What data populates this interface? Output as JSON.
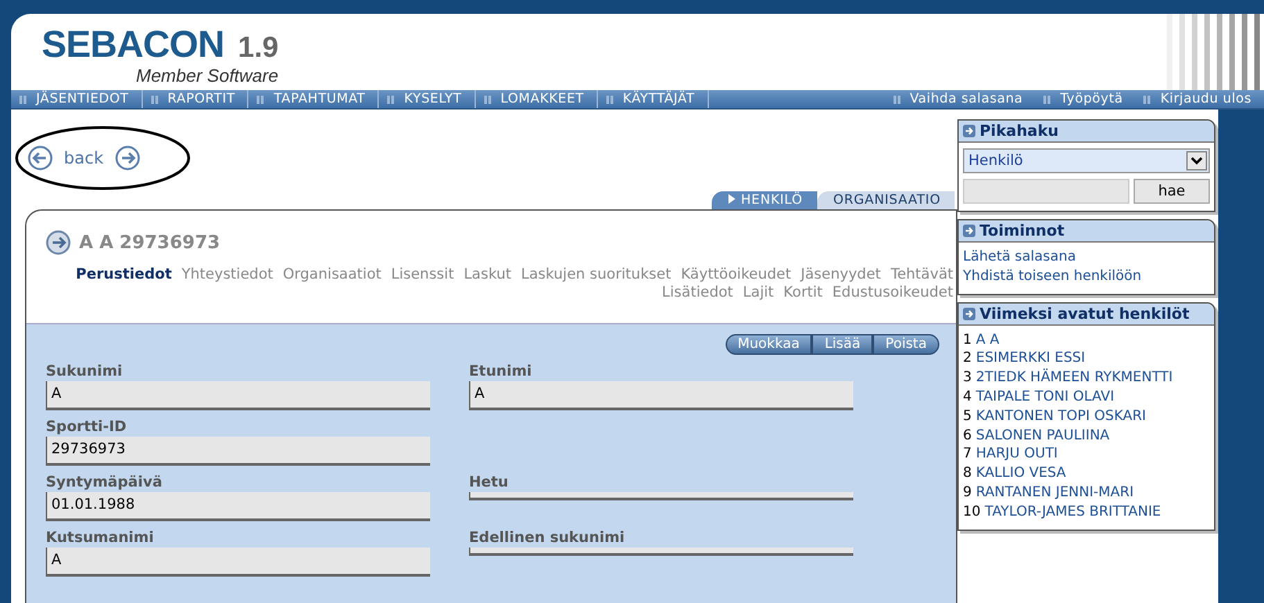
{
  "header": {
    "logo": "SEBACON",
    "version": "1.9",
    "subtitle": "Member Software"
  },
  "nav": {
    "left": [
      "JÄSENTIEDOT",
      "RAPORTIT",
      "TAPAHTUMAT",
      "KYSELYT",
      "LOMAKKEET",
      "KÄYTTÄJÄT"
    ],
    "right": [
      "Vaihda salasana",
      "Työpöytä",
      "Kirjaudu ulos"
    ]
  },
  "back": {
    "label": "back"
  },
  "entity_tabs": [
    {
      "label": "HENKILÖ",
      "selected": true
    },
    {
      "label": "ORGANISAATIO",
      "selected": false
    }
  ],
  "record": {
    "title": "A A 29736973",
    "subtab_rows": [
      {
        "items": [
          {
            "label": "Perustiedot",
            "selected": true
          },
          {
            "label": "Yhteystiedot",
            "selected": false
          },
          {
            "label": "Organisaatiot",
            "selected": false
          },
          {
            "label": "Lisenssit",
            "selected": false
          },
          {
            "label": "Laskut",
            "selected": false
          },
          {
            "label": "Laskujen suoritukset",
            "selected": false
          },
          {
            "label": "Käyttöoikeudet",
            "selected": false
          },
          {
            "label": "Jäsenyydet",
            "selected": false
          },
          {
            "label": "Tehtävät",
            "selected": false
          }
        ]
      },
      {
        "items": [
          {
            "label": "Lisätiedot",
            "selected": false
          },
          {
            "label": "Lajit",
            "selected": false
          },
          {
            "label": "Kortit",
            "selected": false
          },
          {
            "label": "Edustusoikeudet",
            "selected": false
          }
        ]
      }
    ],
    "actions": [
      "Muokkaa",
      "Lisää",
      "Poista"
    ],
    "field_rows": [
      {
        "left": {
          "label": "Sukunimi",
          "value": "A"
        },
        "right": {
          "label": "Etunimi",
          "value": "A"
        }
      },
      {
        "left": {
          "label": "Sportti-ID",
          "value": "29736973"
        }
      },
      {
        "left": {
          "label": "Syntymäpäivä",
          "value": "01.01.1988"
        },
        "right": {
          "label": "Hetu"
        }
      },
      {
        "left": {
          "label": "Kutsumanimi",
          "value": "A"
        },
        "right": {
          "label": "Edellinen sukunimi"
        }
      }
    ]
  },
  "sidebar": {
    "quick_search": {
      "title": "Pikahaku",
      "select": "Henkilö",
      "button": "hae"
    },
    "actions": {
      "title": "Toiminnot",
      "links": [
        "Lähetä salasana",
        "Yhdistä toiseen henkilöön"
      ]
    },
    "recent": {
      "title": "Viimeksi avatut henkilöt",
      "items": [
        {
          "number": "1",
          "name": "A A"
        },
        {
          "number": "2",
          "name": "ESIMERKKI ESSI"
        },
        {
          "number": "3",
          "name": "2TIEDK HÄMEEN RYKMENTTI"
        },
        {
          "number": "4",
          "name": "TAIPALE TONI OLAVI"
        },
        {
          "number": "5",
          "name": "KANTONEN TOPI OSKARI"
        },
        {
          "number": "6",
          "name": "SALONEN PAULIINA"
        },
        {
          "number": "7",
          "name": "HARJU OUTI"
        },
        {
          "number": "8",
          "name": "KALLIO VESA"
        },
        {
          "number": "9",
          "name": "RANTANEN JENNI-MARI"
        },
        {
          "number": "10",
          "name": "TAYLOR-JAMES BRITTANIE"
        }
      ]
    }
  }
}
